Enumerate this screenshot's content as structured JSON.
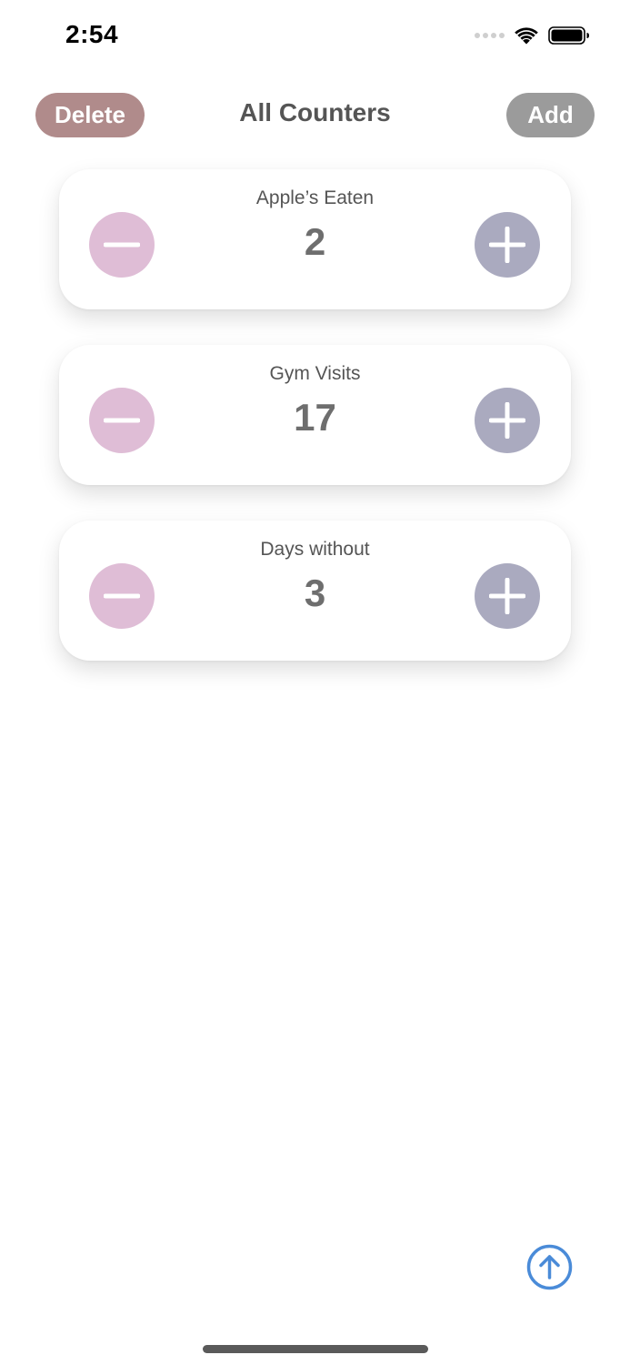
{
  "status_bar": {
    "time": "2:54",
    "wifi_icon": "wifi-icon",
    "battery_icon": "battery-icon"
  },
  "header": {
    "title": "All Counters",
    "delete_label": "Delete",
    "add_label": "Add",
    "delete_color": "#b08b8b",
    "add_color": "#9b9b9b"
  },
  "counters": [
    {
      "name": "Apple’s Eaten",
      "value": "2"
    },
    {
      "name": "Gym Visits",
      "value": "17"
    },
    {
      "name": "Days without",
      "value": "3"
    }
  ],
  "colors": {
    "minus_button": "#dfbdd6",
    "plus_button": "#aaaabf",
    "scroll_top_accent": "#4a8bd8"
  },
  "icons": {
    "decrement": "minus-icon",
    "increment": "plus-icon",
    "scroll_top": "arrow-up-circle-icon"
  }
}
